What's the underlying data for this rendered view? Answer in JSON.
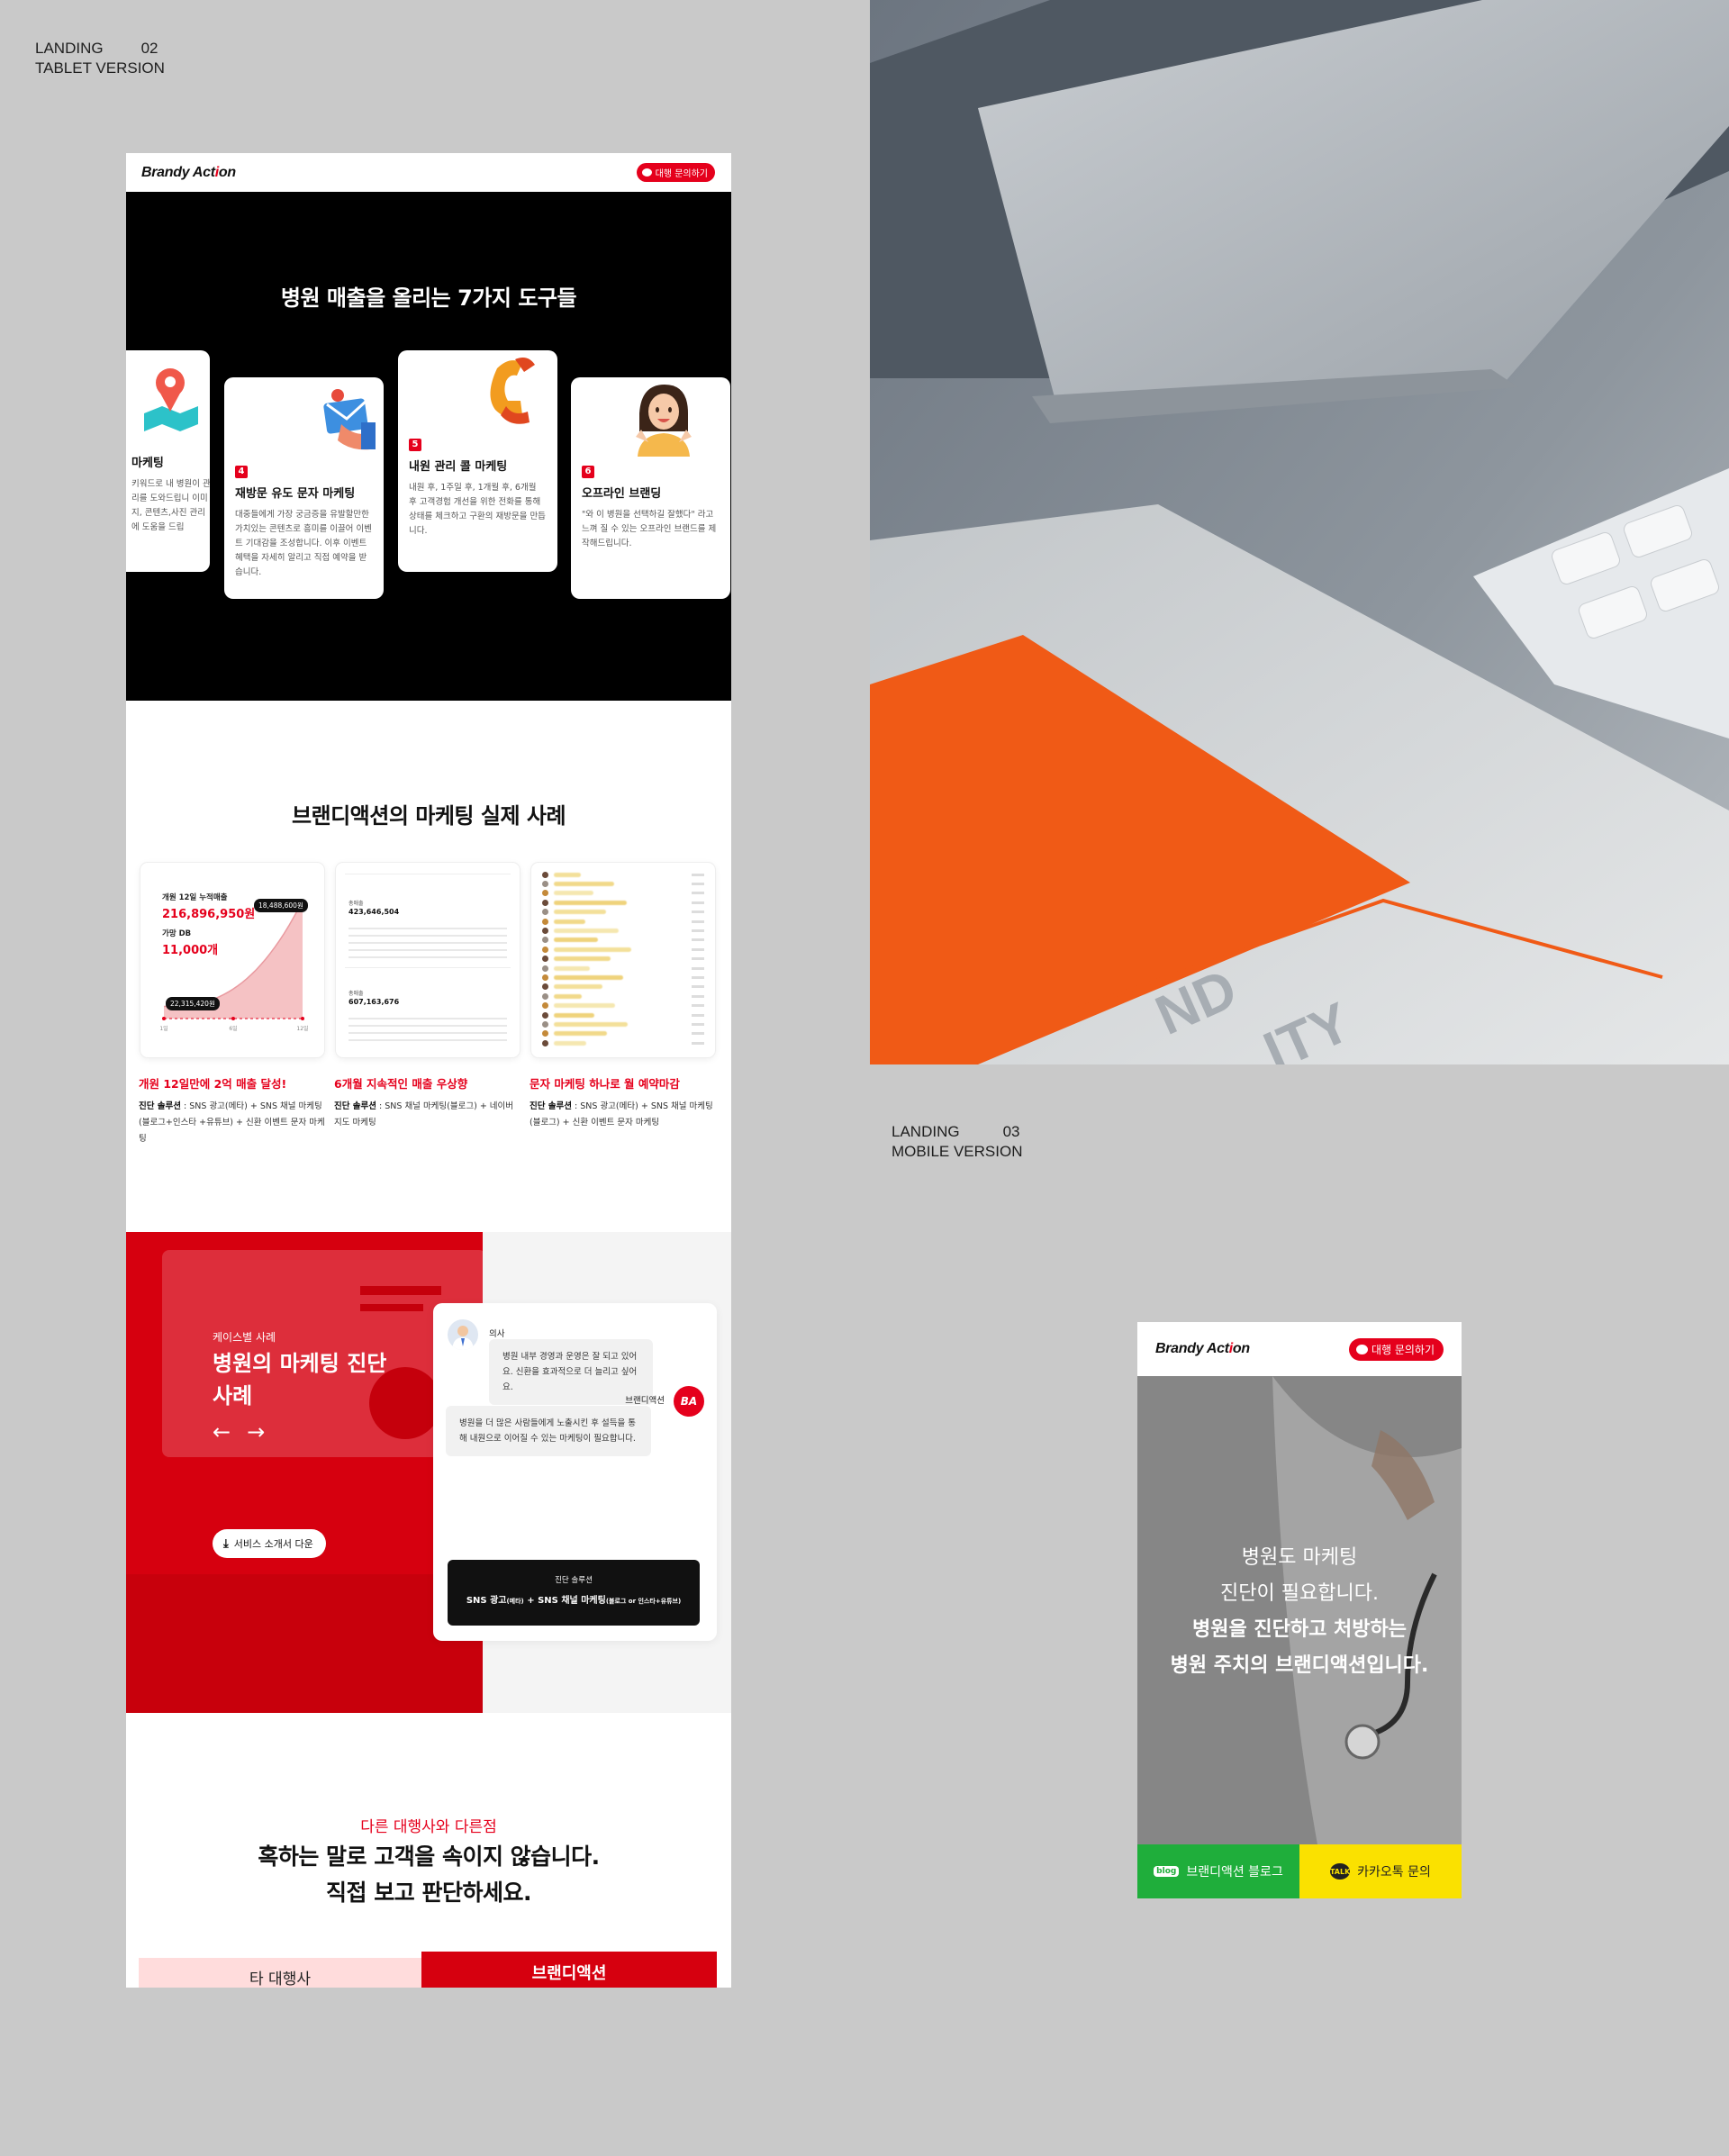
{
  "labels": {
    "tablet": {
      "line1": "LANDING",
      "num": "02",
      "line2": "TABLET VERSION"
    },
    "mobile": {
      "line1": "LANDING",
      "num": "03",
      "line2": "MOBILE VERSION"
    }
  },
  "brand": {
    "logo_pre": "Brandy Act",
    "logo_i": "i",
    "logo_post": "on",
    "cta": "대행 문의하기"
  },
  "colors": {
    "accent": "#e5001c",
    "dark": "#000000",
    "kakao": "#fae100",
    "blog": "#1fae3b"
  },
  "tools": {
    "heading": "병원 매출을 올리는 7가지 도구들",
    "cards": [
      {
        "num": "",
        "title": "마케팅",
        "desc": "키워드로 내 병원이 관리를 도와드립니 이미지, 콘텐츠,사진 관리에 도움을 드립"
      },
      {
        "num": "4",
        "title": "재방문 유도 문자 마케팅",
        "desc": "대중들에게 가장 궁금증을 유발할만한 가치있는 콘텐츠로 흥미를 이끌어 이벤트 기대감을 조성합니다. 이후 이벤트 혜택을 자세히 알리고 직접 예약을 받습니다."
      },
      {
        "num": "5",
        "title": "내원 관리 콜 마케팅",
        "desc": "내원 후, 1주일 후, 1개월 후, 6개월 후 고객경험 개선을 위한 전화를 통해 상태를 체크하고 구환의 재방문을 만듭니다."
      },
      {
        "num": "6",
        "title": "오프라인 브랜딩",
        "desc": "\"와 이 병원을 선택하길 잘했다\" 라고 느껴 질 수 있는 오프라인 브랜드를 제작해드립니다."
      }
    ]
  },
  "cases": {
    "heading": "브랜디액션의 마케팅 실제 사례",
    "items": [
      {
        "title": "개원 12일만에 2억 매출 달성!",
        "label": "진단 솔루션",
        "desc": " : SNS 광고(메타) + SNS 채널 마케팅(블로그+인스타 +유튜브) + 신환 이벤트 문자 마케팅"
      },
      {
        "title": "6개월 지속적인 매출 우상향",
        "label": "진단 솔루션",
        "desc": " : SNS 채널 마케팅(블로그) + 네이버 지도 마케팅"
      },
      {
        "title": "문자 마케팅 하나로 월 예약마감",
        "label": "진단 솔루션",
        "desc": " : SNS 광고(메타) + SNS 채널 마케팅(블로그) + 신환 이벤트 문자 마케팅"
      }
    ]
  },
  "chart_data": {
    "type": "area",
    "card_label1": "개원 12일 누적매출",
    "card_value1": "216,896,950원",
    "card_label2": "가망 DB",
    "card_value2": "11,000개",
    "tag_high": "18,488,600원",
    "tag_low": "22,315,420원",
    "x": [
      "1일",
      "6일",
      "12일"
    ],
    "y": [
      22315420,
      60000000,
      216896950
    ]
  },
  "card2": {
    "label": "총매출",
    "v1": "423,646,504",
    "v2": "607,163,676"
  },
  "diagnosis": {
    "sub": "케이스별 사례",
    "title": "병원의 마케팅 진단 사례",
    "download": "서비스 소개서 다운",
    "doctor_name": "의사",
    "doctor_msg": "병원 내부 경영과 운영은 잘 되고 있어요. 신환을 효과적으로 더 늘리고 싶어요.",
    "ba_name": "브랜디액션",
    "ba_initials": "BA",
    "ba_msg": "병원을 더 많은 사람들에게 노출시킨 후 설득을 통해 내원으로 이어질 수 있는 마케팅이 필요합니다.",
    "sol_label": "진단 솔루션",
    "sol_text_a": "SNS 광고",
    "sol_text_a2": "(메타)",
    "sol_text_b": " + SNS 채널 마케팅",
    "sol_text_b2": "(블로그 or 인스타+유튜브)"
  },
  "compare": {
    "kicker": "다른 대행사와 다른점",
    "line1": "혹하는 말로 고객을 속이지 않습니다.",
    "line2": "직접 보고 판단하세요.",
    "left": "타 대행사",
    "right": "브랜디액션"
  },
  "mobile": {
    "hero_l1": "병원도 마케팅",
    "hero_l2": "진단이 필요합니다.",
    "hero_l3": "병원을 진단하고 처방하는",
    "hero_l4": "병원 주치의 브랜디액션입니다.",
    "blog_badge": "blog",
    "blog_btn": "브랜디액션 블로그",
    "talk_badge": "TALK",
    "talk_btn": "카카오톡 문의"
  }
}
